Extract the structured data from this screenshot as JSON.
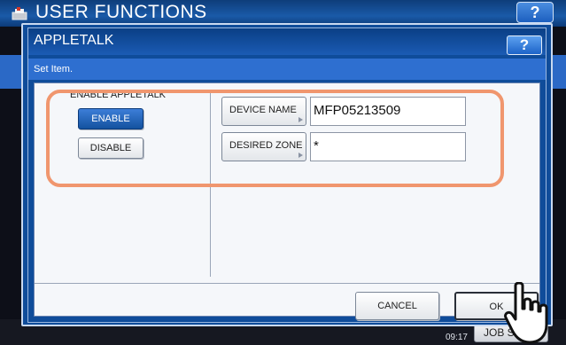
{
  "background": {
    "title": "USER FUNCTIONS",
    "help_label": "?",
    "datetime_line2": "09:17",
    "job_label": "JOB S"
  },
  "dialog": {
    "title": "APPLETALK",
    "help_label": "?",
    "subtitle": "Set Item.",
    "enable_group": {
      "label": "ENABLE APPLETALK",
      "enable_label": "ENABLE",
      "disable_label": "DISABLE",
      "selected": "ENABLE"
    },
    "device_name": {
      "button_label": "DEVICE NAME",
      "value": "MFP05213509"
    },
    "desired_zone": {
      "button_label": "DESIRED ZONE",
      "value": "*"
    },
    "cancel_label": "CANCEL",
    "ok_label": "OK"
  },
  "colors": {
    "title_blue": "#1b5bb4",
    "selected_blue": "#13529f",
    "highlight_orange": "#f0966e"
  },
  "icons": [
    "printer-icon",
    "help-icon",
    "pointer-hand-icon"
  ]
}
